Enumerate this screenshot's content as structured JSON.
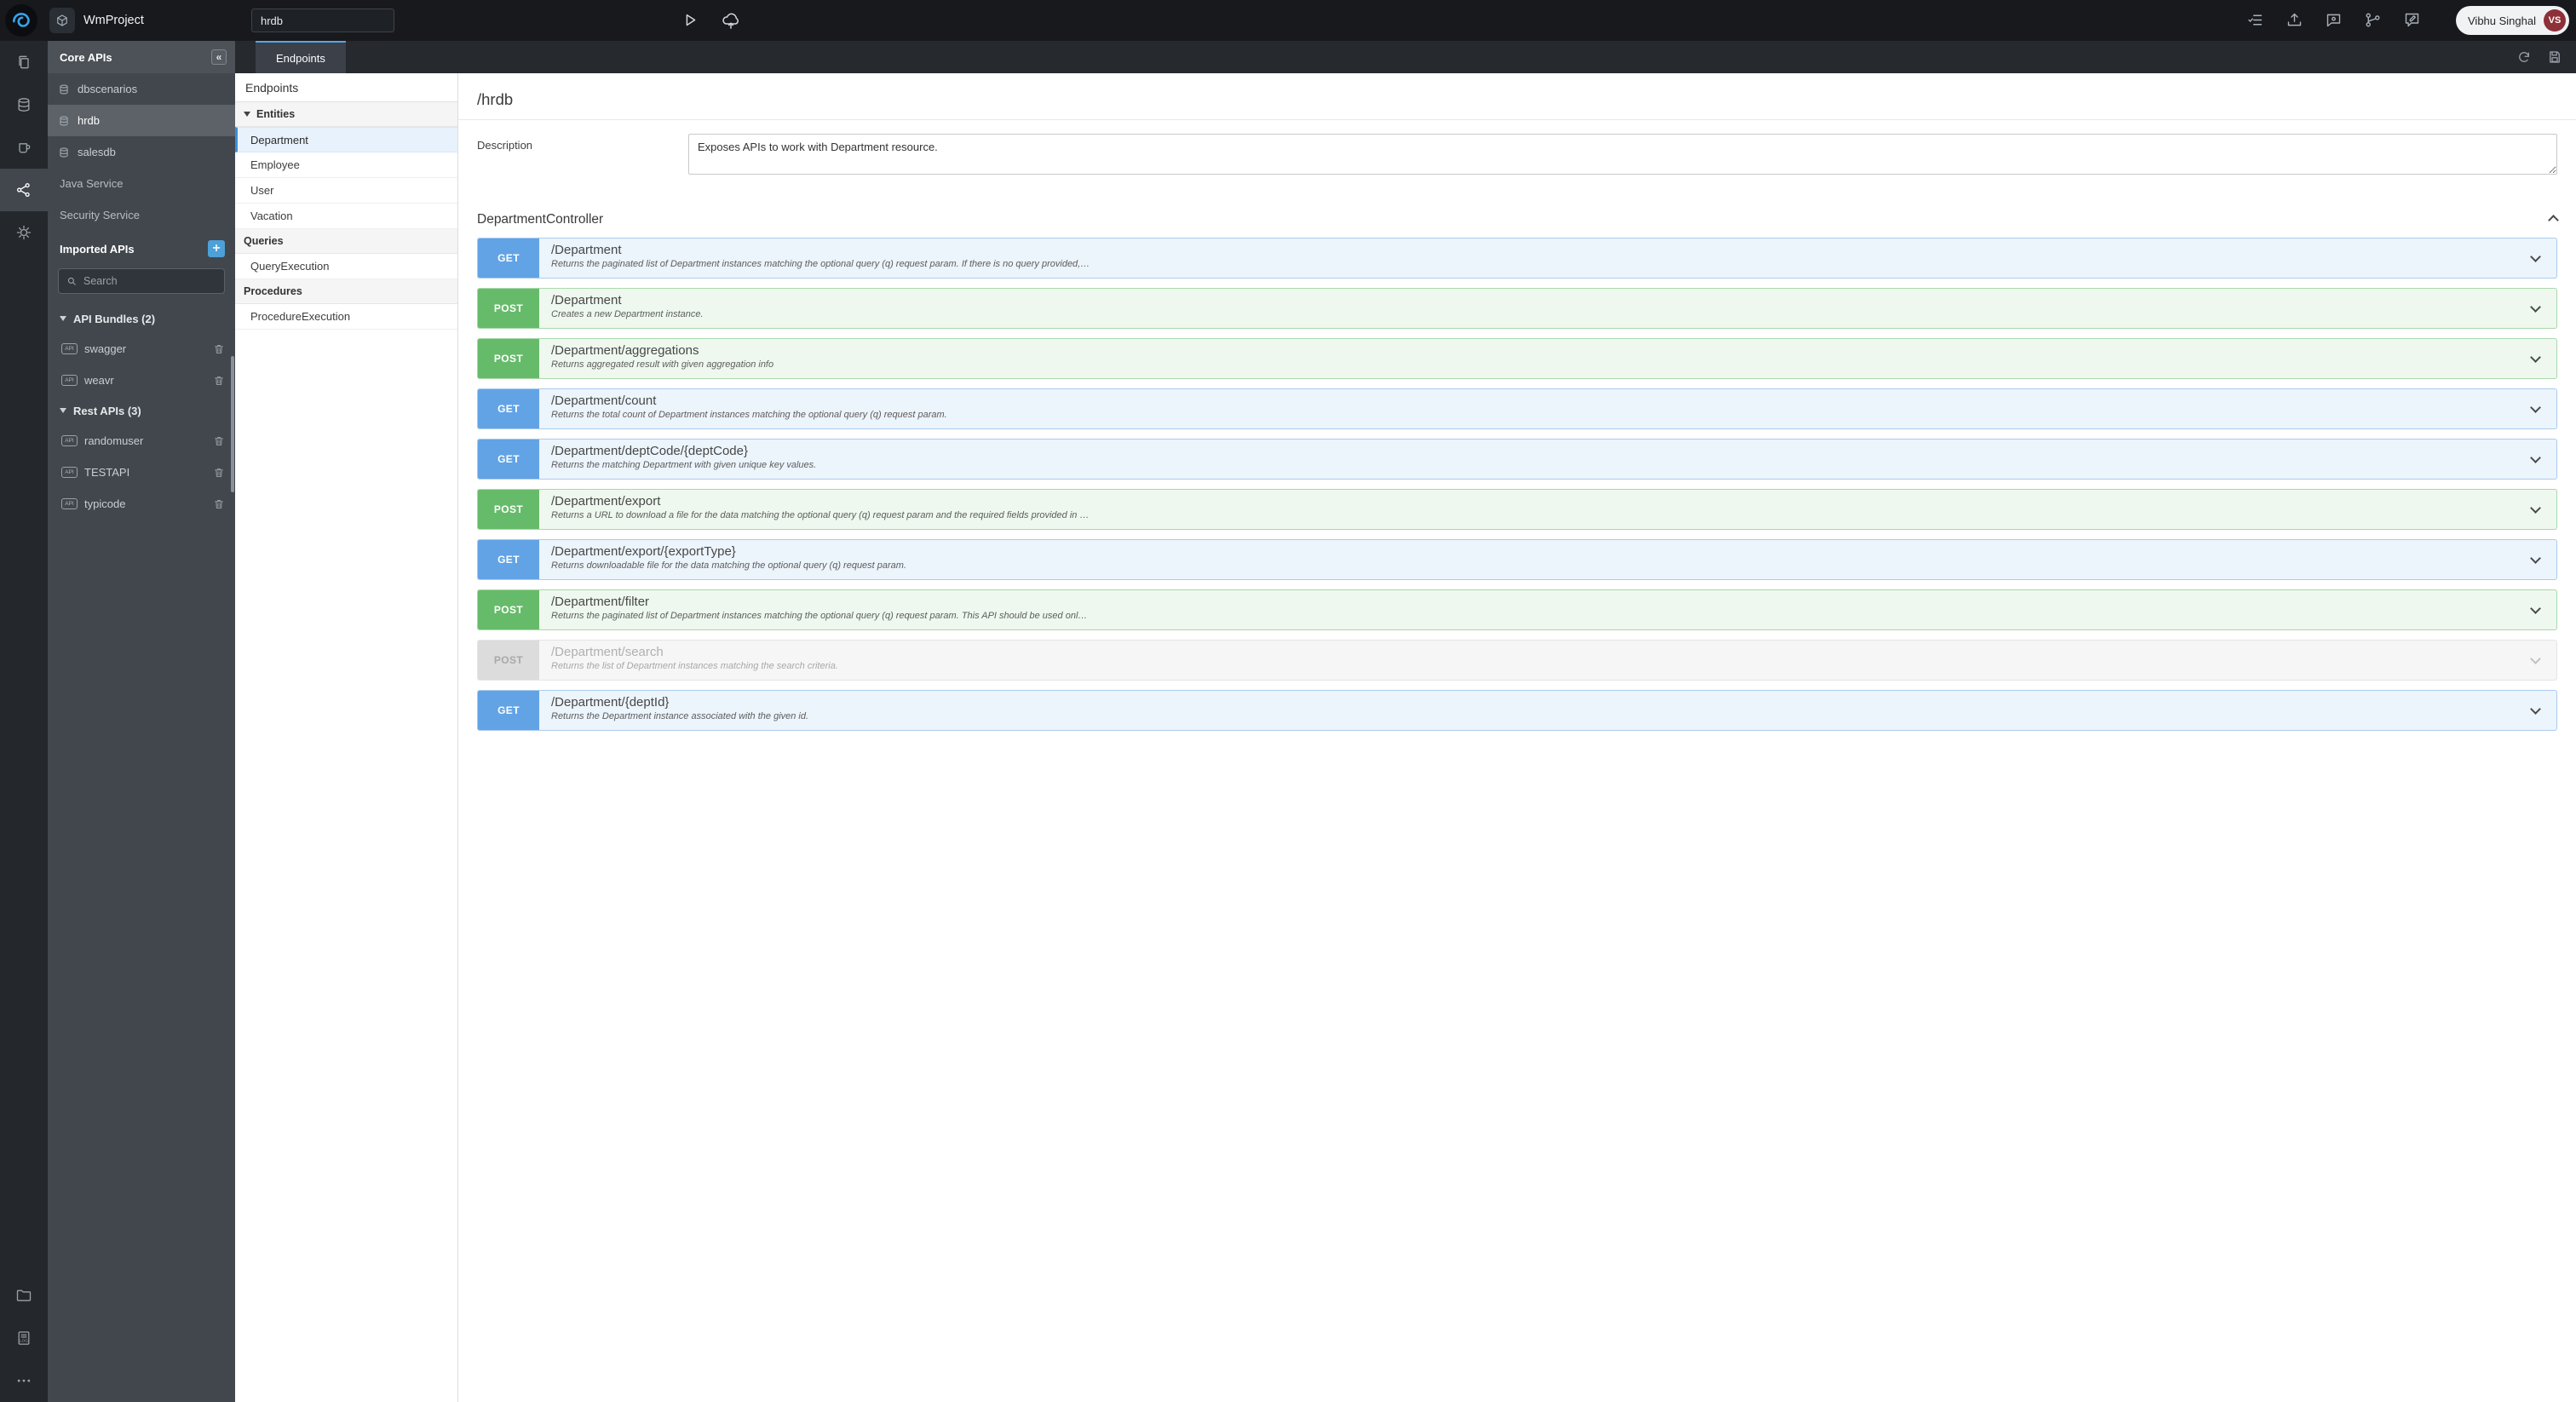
{
  "topbar": {
    "project_name": "WmProject",
    "search_value": "hrdb",
    "user_name": "Vibhu Singhal",
    "user_initials": "VS"
  },
  "rail": {
    "items": [
      "pages",
      "databases",
      "java-services",
      "apis",
      "settings",
      "folder",
      "logs",
      "more"
    ]
  },
  "sidebar": {
    "header": "Core APIs",
    "collapse_glyph": "«",
    "add_glyph": "+",
    "api_badge": "API",
    "search_placeholder": "Search",
    "items": [
      {
        "label": "dbscenarios"
      },
      {
        "label": "hrdb",
        "selected": true
      },
      {
        "label": "salesdb"
      },
      {
        "label": "Java Service"
      },
      {
        "label": "Security Service"
      }
    ],
    "imported_title": "Imported APIs",
    "groups": [
      {
        "title": "API Bundles (2)",
        "items": [
          {
            "label": "swagger"
          },
          {
            "label": "weavr"
          }
        ]
      },
      {
        "title": "Rest APIs (3)",
        "items": [
          {
            "label": "randomuser"
          },
          {
            "label": "TESTAPI"
          },
          {
            "label": "typicode"
          }
        ]
      }
    ]
  },
  "tabs": {
    "active": "Endpoints"
  },
  "tree": {
    "title": "Endpoints",
    "sections": [
      {
        "title": "Entities",
        "items": [
          {
            "label": "Department",
            "selected": true
          },
          {
            "label": "Employee"
          },
          {
            "label": "User"
          },
          {
            "label": "Vacation"
          }
        ]
      },
      {
        "title": "Queries",
        "items": [
          {
            "label": "QueryExecution"
          }
        ]
      },
      {
        "title": "Procedures",
        "items": [
          {
            "label": "ProcedureExecution"
          }
        ]
      }
    ]
  },
  "main": {
    "title": "/hrdb",
    "description_label": "Description",
    "description_value": "Exposes APIs to work with Department resource.",
    "controller": "DepartmentController",
    "endpoints": [
      {
        "method": "GET",
        "path": "/Department",
        "desc": "Returns the paginated list of Department instances matching the optional query (q) request param. If there is no query provided,…"
      },
      {
        "method": "POST",
        "path": "/Department",
        "desc": "Creates a new Department instance."
      },
      {
        "method": "POST",
        "path": "/Department/aggregations",
        "desc": "Returns aggregated result with given aggregation info"
      },
      {
        "method": "GET",
        "path": "/Department/count",
        "desc": "Returns the total count of Department instances matching the optional query (q) request param."
      },
      {
        "method": "GET",
        "path": "/Department/deptCode/{deptCode}",
        "desc": "Returns the matching Department with given unique key values."
      },
      {
        "method": "POST",
        "path": "/Department/export",
        "desc": "Returns a URL to download a file for the data matching the optional query (q) request param and the required fields provided in …"
      },
      {
        "method": "GET",
        "path": "/Department/export/{exportType}",
        "desc": "Returns downloadable file for the data matching the optional query (q) request param."
      },
      {
        "method": "POST",
        "path": "/Department/filter",
        "desc": "Returns the paginated list of Department instances matching the optional query (q) request param. This API should be used onl…"
      },
      {
        "method": "POST",
        "path": "/Department/search",
        "desc": "Returns the list of Department instances matching the search criteria.",
        "disabled": true
      },
      {
        "method": "GET",
        "path": "/Department/{deptId}",
        "desc": "Returns the Department instance associated with the given id."
      }
    ]
  },
  "colors": {
    "get_badge": "#61a3e5",
    "post_badge": "#66bb6a",
    "accent_blue": "#4da0d8"
  }
}
